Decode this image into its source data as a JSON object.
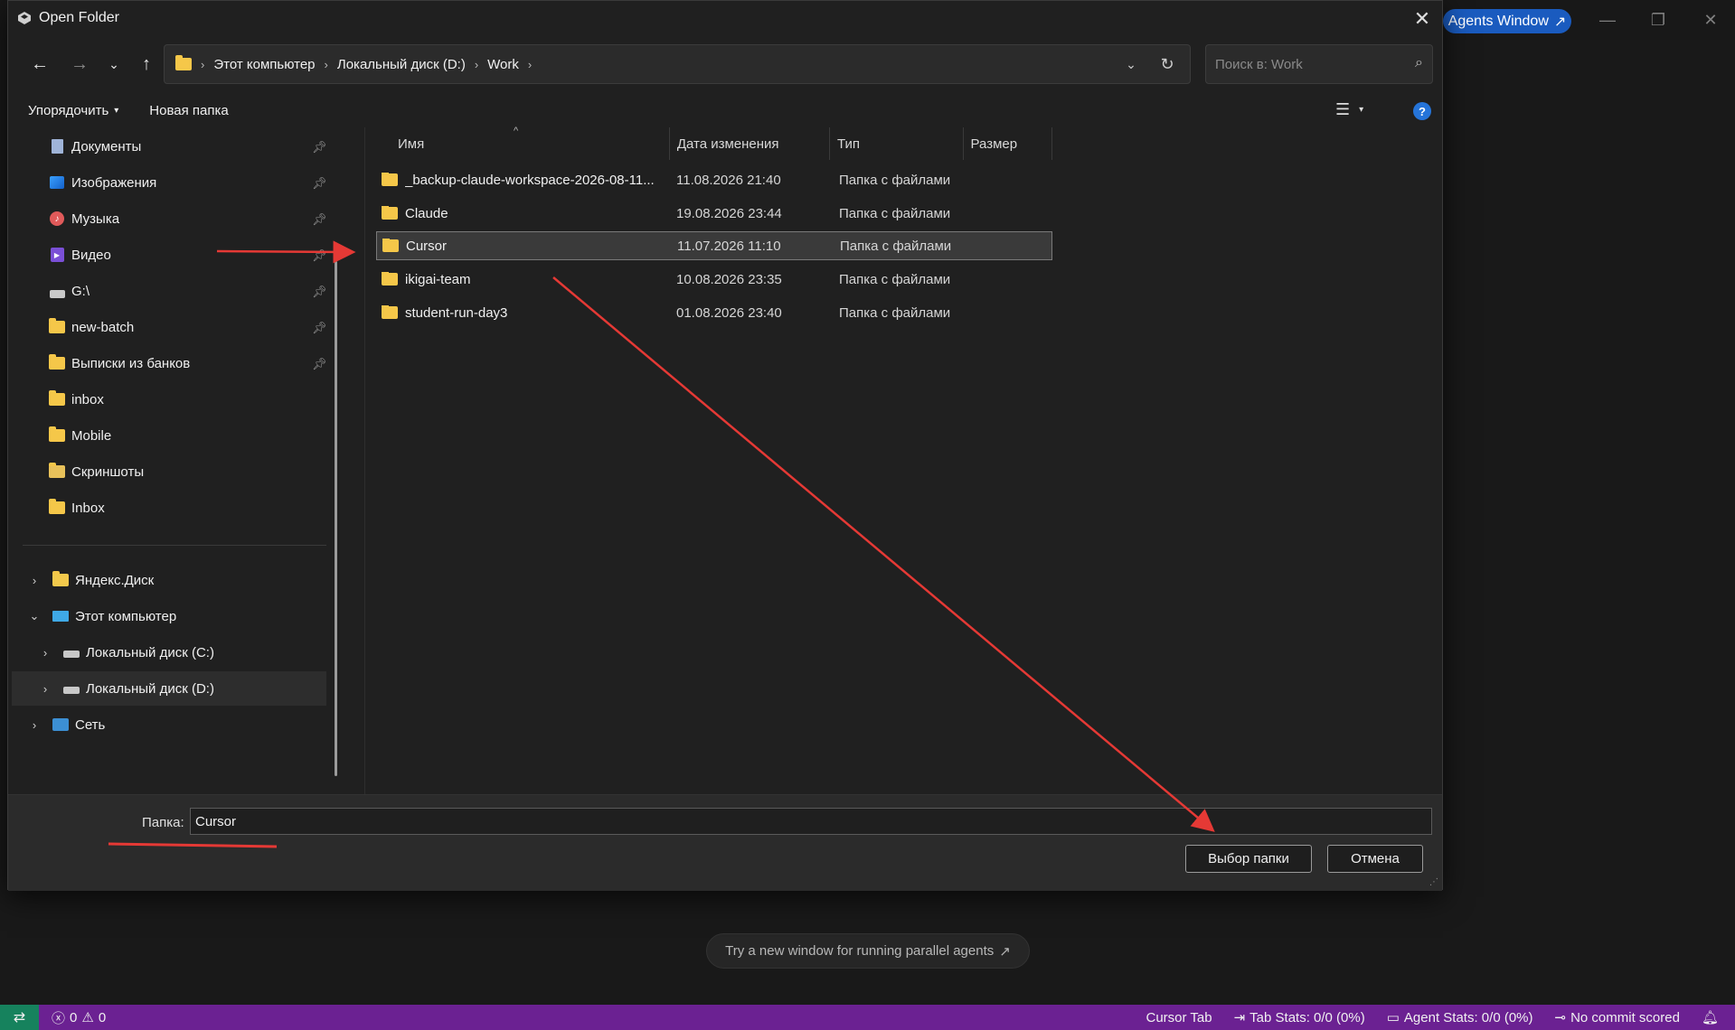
{
  "app": {
    "agents_window_label": "Agents Window",
    "agents_window_arrow": "↗",
    "parallel_hint": "Try a new window for running parallel agents",
    "parallel_hint_arrow": "↗"
  },
  "statusbar": {
    "errors": "0",
    "warnings": "0",
    "cursor_tab": "Cursor Tab",
    "tab_stats": "Tab Stats: 0/0 (0%)",
    "agent_stats": "Agent Stats: 0/0 (0%)",
    "commit": "No commit scored"
  },
  "dialog": {
    "title": "Open Folder",
    "breadcrumb": [
      "Этот компьютер",
      "Локальный диск (D:)",
      "Work"
    ],
    "search_placeholder": "Поиск в: Work",
    "commands": {
      "organize": "Упорядочить",
      "new_folder": "Новая папка"
    },
    "nav_quick": [
      {
        "label": "Документы",
        "icon": "documents-icon"
      },
      {
        "label": "Изображения",
        "icon": "pictures-icon"
      },
      {
        "label": "Музыка",
        "icon": "music-icon"
      },
      {
        "label": "Видео",
        "icon": "video-icon"
      },
      {
        "label": "G:\\",
        "icon": "network-drive-icon"
      },
      {
        "label": "new-batch",
        "icon": "folder-icon"
      },
      {
        "label": "Выписки из банков",
        "icon": "folder-icon"
      },
      {
        "label": "inbox",
        "icon": "folder-icon"
      },
      {
        "label": "Mobile",
        "icon": "folder-icon"
      },
      {
        "label": "Скриншоты",
        "icon": "screenshots-folder-icon"
      },
      {
        "label": "Inbox",
        "icon": "folder-icon"
      }
    ],
    "nav_tree": [
      {
        "label": "Яндекс.Диск",
        "icon": "yandex-disk-icon"
      },
      {
        "label": "Этот компьютер",
        "icon": "computer-icon"
      },
      {
        "label": "Локальный диск (C:)",
        "icon": "drive-icon"
      },
      {
        "label": "Локальный диск (D:)",
        "icon": "drive-icon"
      },
      {
        "label": "Сеть",
        "icon": "network-icon"
      }
    ],
    "columns": {
      "name": "Имя",
      "date": "Дата изменения",
      "type": "Тип",
      "size": "Размер"
    },
    "files": [
      {
        "name": "_backup-claude-workspace-2026-08-11...",
        "date": "11.08.2026 21:40",
        "type": "Папка с файлами"
      },
      {
        "name": "Claude",
        "date": "19.08.2026 23:44",
        "type": "Папка с файлами"
      },
      {
        "name": "Cursor",
        "date": "11.07.2026 11:10",
        "type": "Папка с файлами"
      },
      {
        "name": "ikigai-team",
        "date": "10.08.2026 23:35",
        "type": "Папка с файлами"
      },
      {
        "name": "student-run-day3",
        "date": "01.08.2026 23:40",
        "type": "Папка с файлами"
      }
    ],
    "selected_file": "Cursor",
    "folder_label": "Папка:",
    "folder_value": "Cursor",
    "select_button": "Выбор папки",
    "cancel_button": "Отмена"
  },
  "colors": {
    "statusbar": "#6b2192",
    "remote": "#16825d",
    "accent": "#1a5bbf",
    "folder": "#f5c749",
    "annotation": "#e53935"
  }
}
